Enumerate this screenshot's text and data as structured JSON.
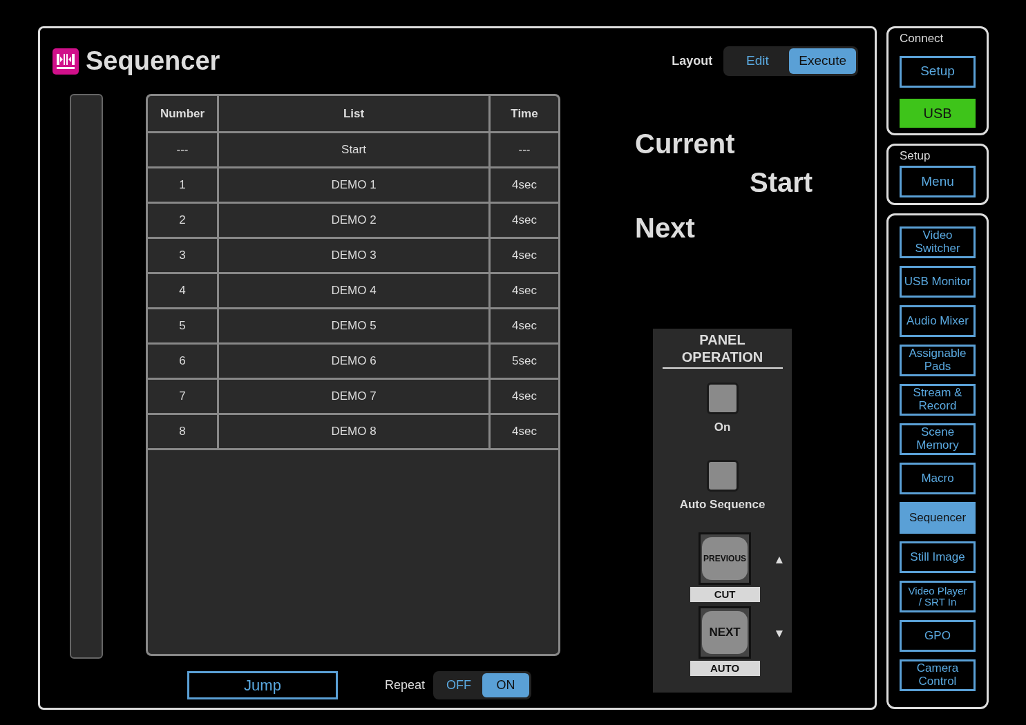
{
  "app": {
    "title": "Sequencer"
  },
  "layout_toggle": {
    "label": "Layout",
    "options": [
      {
        "label": "Edit",
        "selected": false
      },
      {
        "label": "Execute",
        "selected": true
      }
    ]
  },
  "table": {
    "columns": [
      "Number",
      "List",
      "Time"
    ],
    "rows": [
      {
        "number": "---",
        "list": "Start",
        "time": "---"
      },
      {
        "number": "1",
        "list": "DEMO 1",
        "time": "4sec"
      },
      {
        "number": "2",
        "list": "DEMO 2",
        "time": "4sec"
      },
      {
        "number": "3",
        "list": "DEMO 3",
        "time": "4sec"
      },
      {
        "number": "4",
        "list": "DEMO 4",
        "time": "4sec"
      },
      {
        "number": "5",
        "list": "DEMO 5",
        "time": "4sec"
      },
      {
        "number": "6",
        "list": "DEMO 6",
        "time": "5sec"
      },
      {
        "number": "7",
        "list": "DEMO 7",
        "time": "4sec"
      },
      {
        "number": "8",
        "list": "DEMO 8",
        "time": "4sec"
      }
    ]
  },
  "status": {
    "current_label": "Current",
    "current_value": "Start",
    "next_label": "Next"
  },
  "panel_operation": {
    "title": "PANEL OPERATION",
    "switches": [
      {
        "label": "On"
      },
      {
        "label": "Auto Sequence"
      }
    ],
    "keys": [
      {
        "key_label": "PREVIOUS",
        "caption": "CUT",
        "arrow": "▲"
      },
      {
        "key_label": "NEXT",
        "caption": "AUTO",
        "arrow": "▼"
      }
    ]
  },
  "jump_button": "Jump",
  "repeat": {
    "label": "Repeat",
    "options": [
      {
        "label": "OFF",
        "selected": false
      },
      {
        "label": "ON",
        "selected": true
      }
    ]
  },
  "sidebar": {
    "groups": [
      {
        "title": "Connect",
        "items": [
          {
            "label": "Setup",
            "kind": "button",
            "selected": false
          },
          {
            "label": "USB",
            "kind": "indicator"
          }
        ]
      },
      {
        "title": "Setup",
        "items": [
          {
            "label": "Menu",
            "kind": "button",
            "selected": false
          }
        ]
      },
      {
        "items": [
          {
            "label": "Video Switcher",
            "kind": "button",
            "selected": false
          },
          {
            "label": "USB Monitor",
            "kind": "button",
            "selected": false
          },
          {
            "label": "Audio Mixer",
            "kind": "button",
            "selected": false
          },
          {
            "label": "Assignable Pads",
            "kind": "button",
            "selected": false
          },
          {
            "label": "Stream & Record",
            "kind": "button",
            "selected": false
          },
          {
            "label": "Scene Memory",
            "kind": "button",
            "selected": false
          },
          {
            "label": "Macro",
            "kind": "button",
            "selected": false
          },
          {
            "label": "Sequencer",
            "kind": "button",
            "selected": true
          },
          {
            "label": "Still Image",
            "kind": "button",
            "selected": false
          },
          {
            "label": "Video Player / SRT In",
            "kind": "button",
            "selected": false
          },
          {
            "label": "GPO",
            "kind": "button",
            "selected": false
          },
          {
            "label": "Camera Control",
            "kind": "button",
            "selected": false
          }
        ]
      }
    ]
  }
}
